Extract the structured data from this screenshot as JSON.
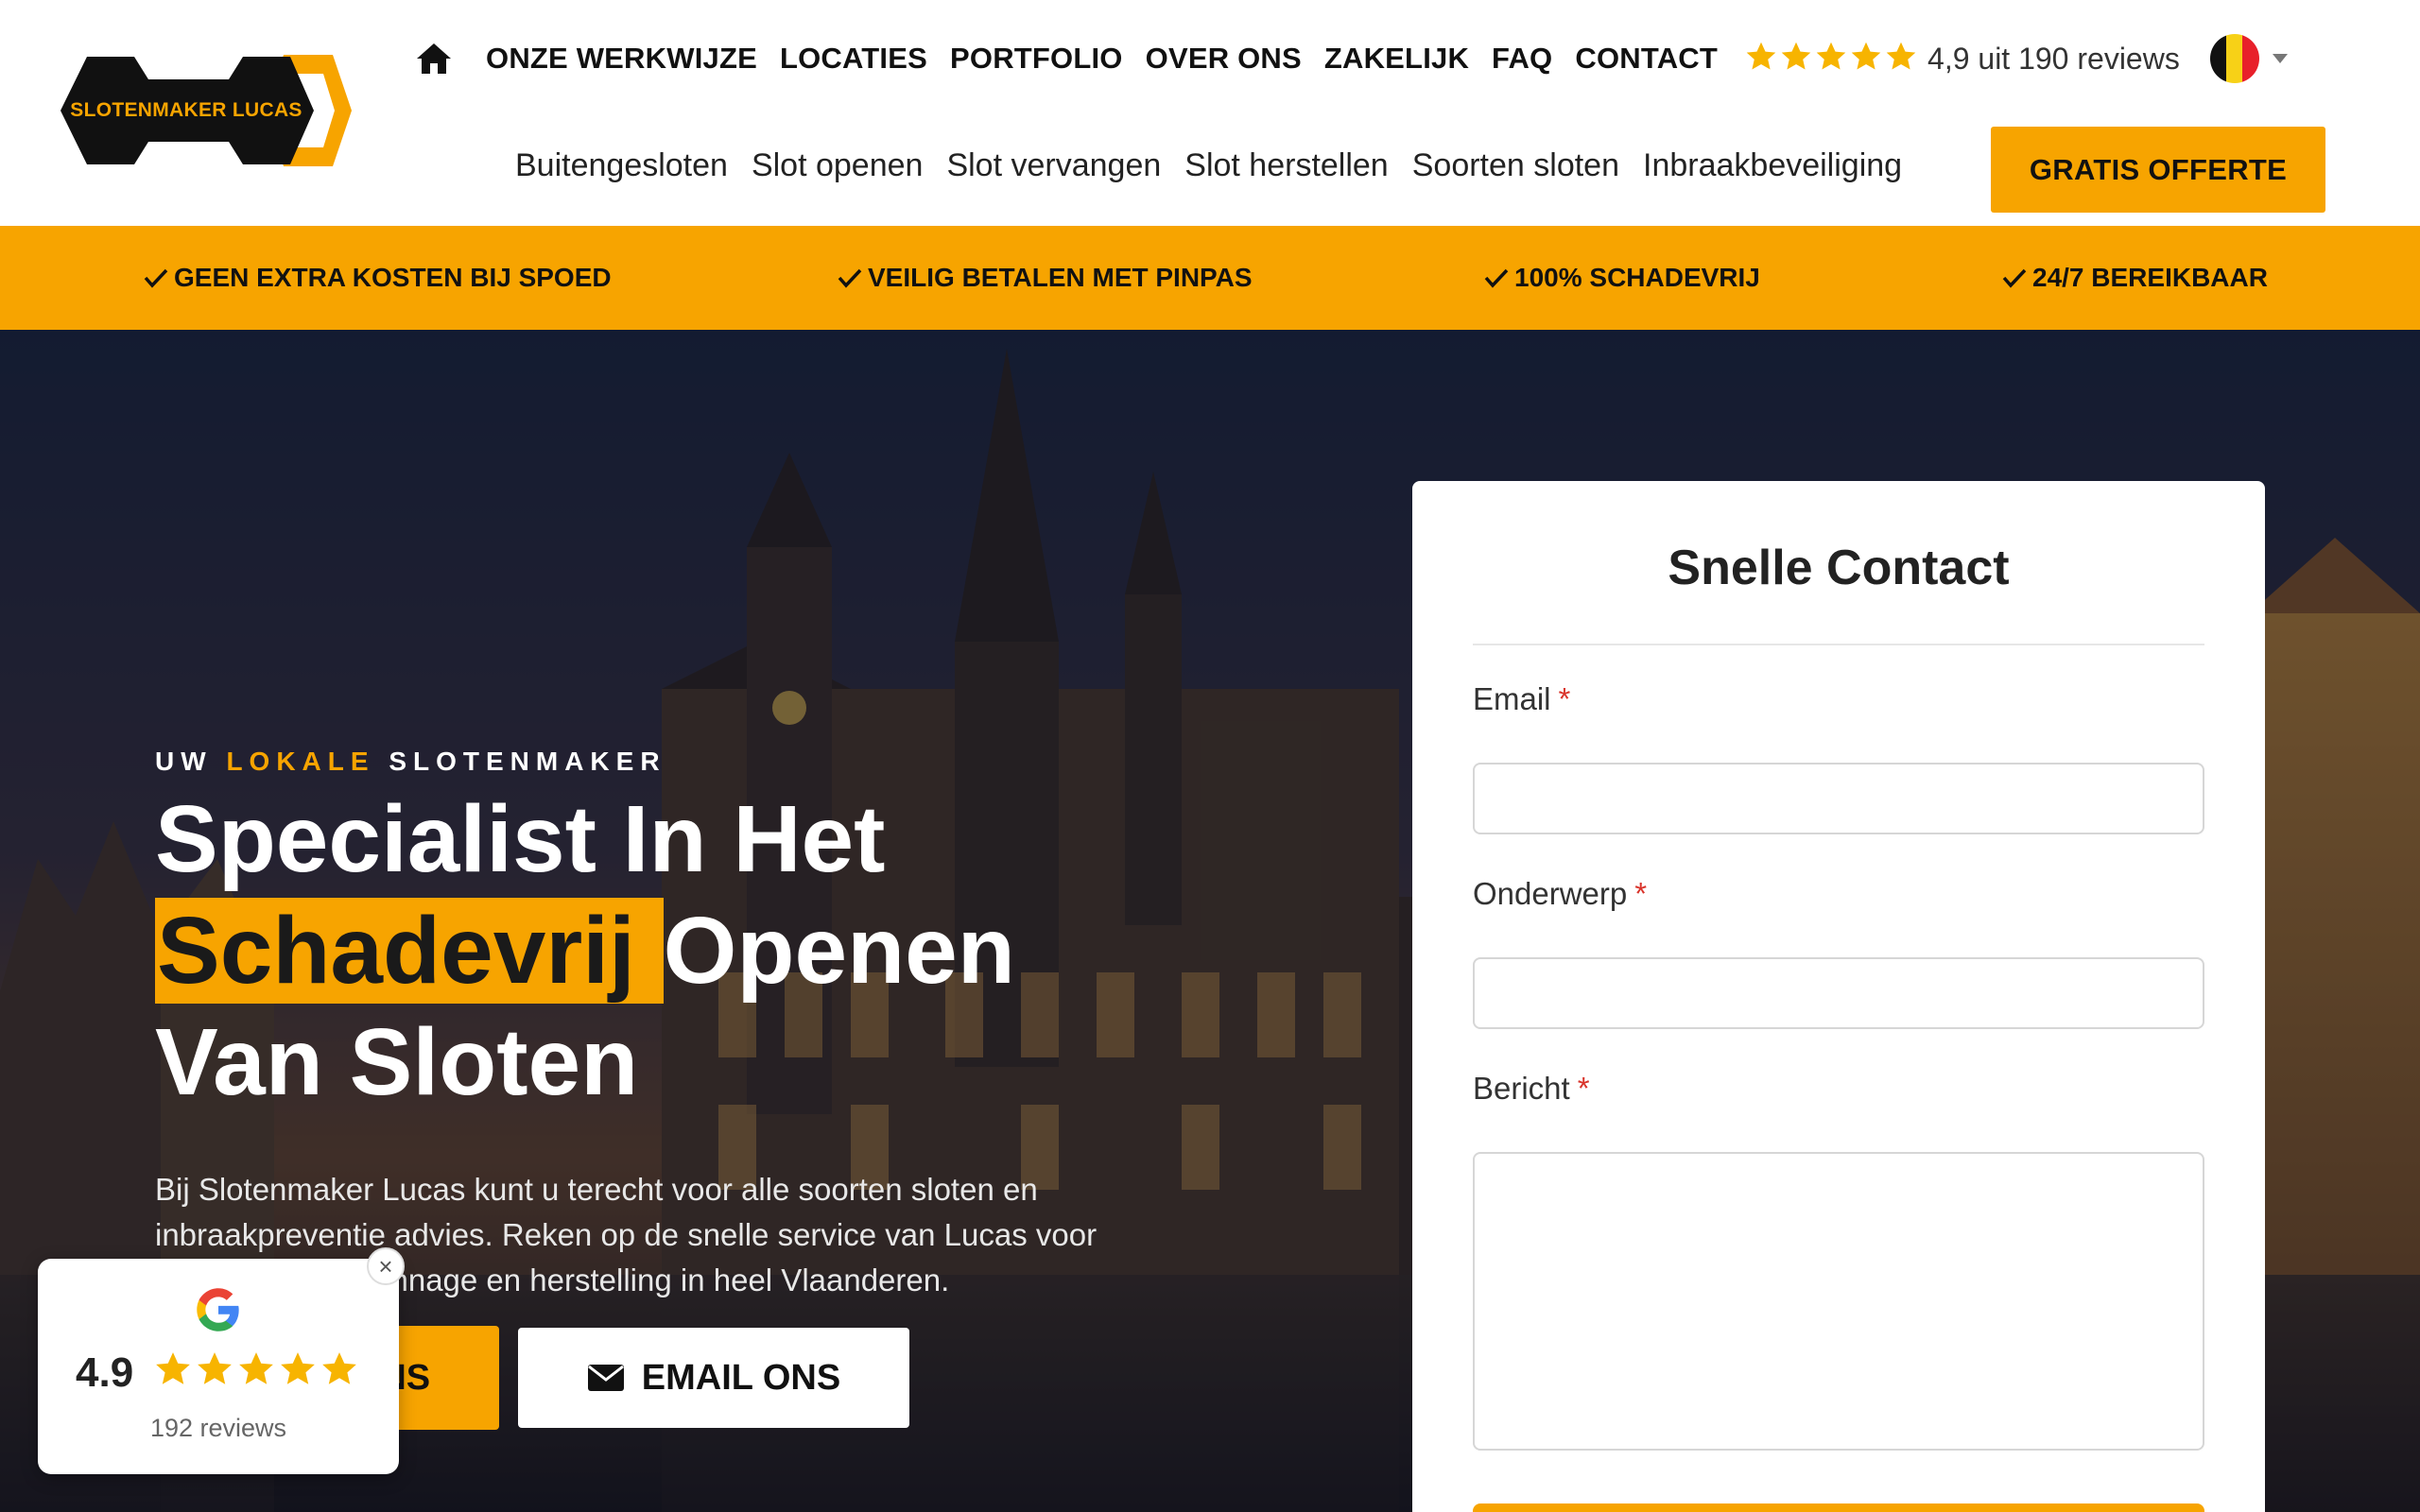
{
  "brand": {
    "name": "SLOTENMAKER LUCAS"
  },
  "nav": {
    "items": [
      "ONZE WERKWIJZE",
      "LOCATIES",
      "PORTFOLIO",
      "OVER ONS",
      "ZAKELIJK",
      "FAQ",
      "CONTACT"
    ],
    "rating_text": "4,9 uit 190 reviews",
    "rating_stars": 5
  },
  "subnav": {
    "items": [
      "Buitengesloten",
      "Slot openen",
      "Slot vervangen",
      "Slot herstellen",
      "Soorten sloten",
      "Inbraakbeveiliging"
    ],
    "cta": "GRATIS OFFERTE"
  },
  "usp": {
    "items": [
      "GEEN EXTRA KOSTEN BIJ SPOED",
      "VEILIG BETALEN MET PINPAS",
      "100% SCHADEVRIJ",
      "24/7 BEREIKBAAR"
    ]
  },
  "hero": {
    "eyebrow_before": "UW ",
    "eyebrow_accent": "LOKALE",
    "eyebrow_after": " SLOTENMAKER",
    "headline_line1": "Specialist In Het",
    "headline_mark": "Schadevrij ",
    "headline_line2_rest": "Openen",
    "headline_line3": "Van Sloten",
    "description": "Bij Slotenmaker Lucas kunt u terecht voor alle soorten sloten en inbraakpreventie advies. Reken op de snelle service van Lucas voor schadevrije depannage en herstelling in heel Vlaanderen.",
    "call_button": "BEL ONS",
    "email_button": "EMAIL ONS"
  },
  "contact": {
    "title": "Snelle Contact",
    "email_label": "Email",
    "subject_label": "Onderwerp",
    "message_label": "Bericht",
    "required_mark": "*"
  },
  "google_widget": {
    "score": "4.9",
    "stars": 5,
    "count": "192 reviews",
    "close": "×"
  },
  "colors": {
    "accent": "#f7a400",
    "dark": "#111111",
    "required": "#d9342b"
  }
}
